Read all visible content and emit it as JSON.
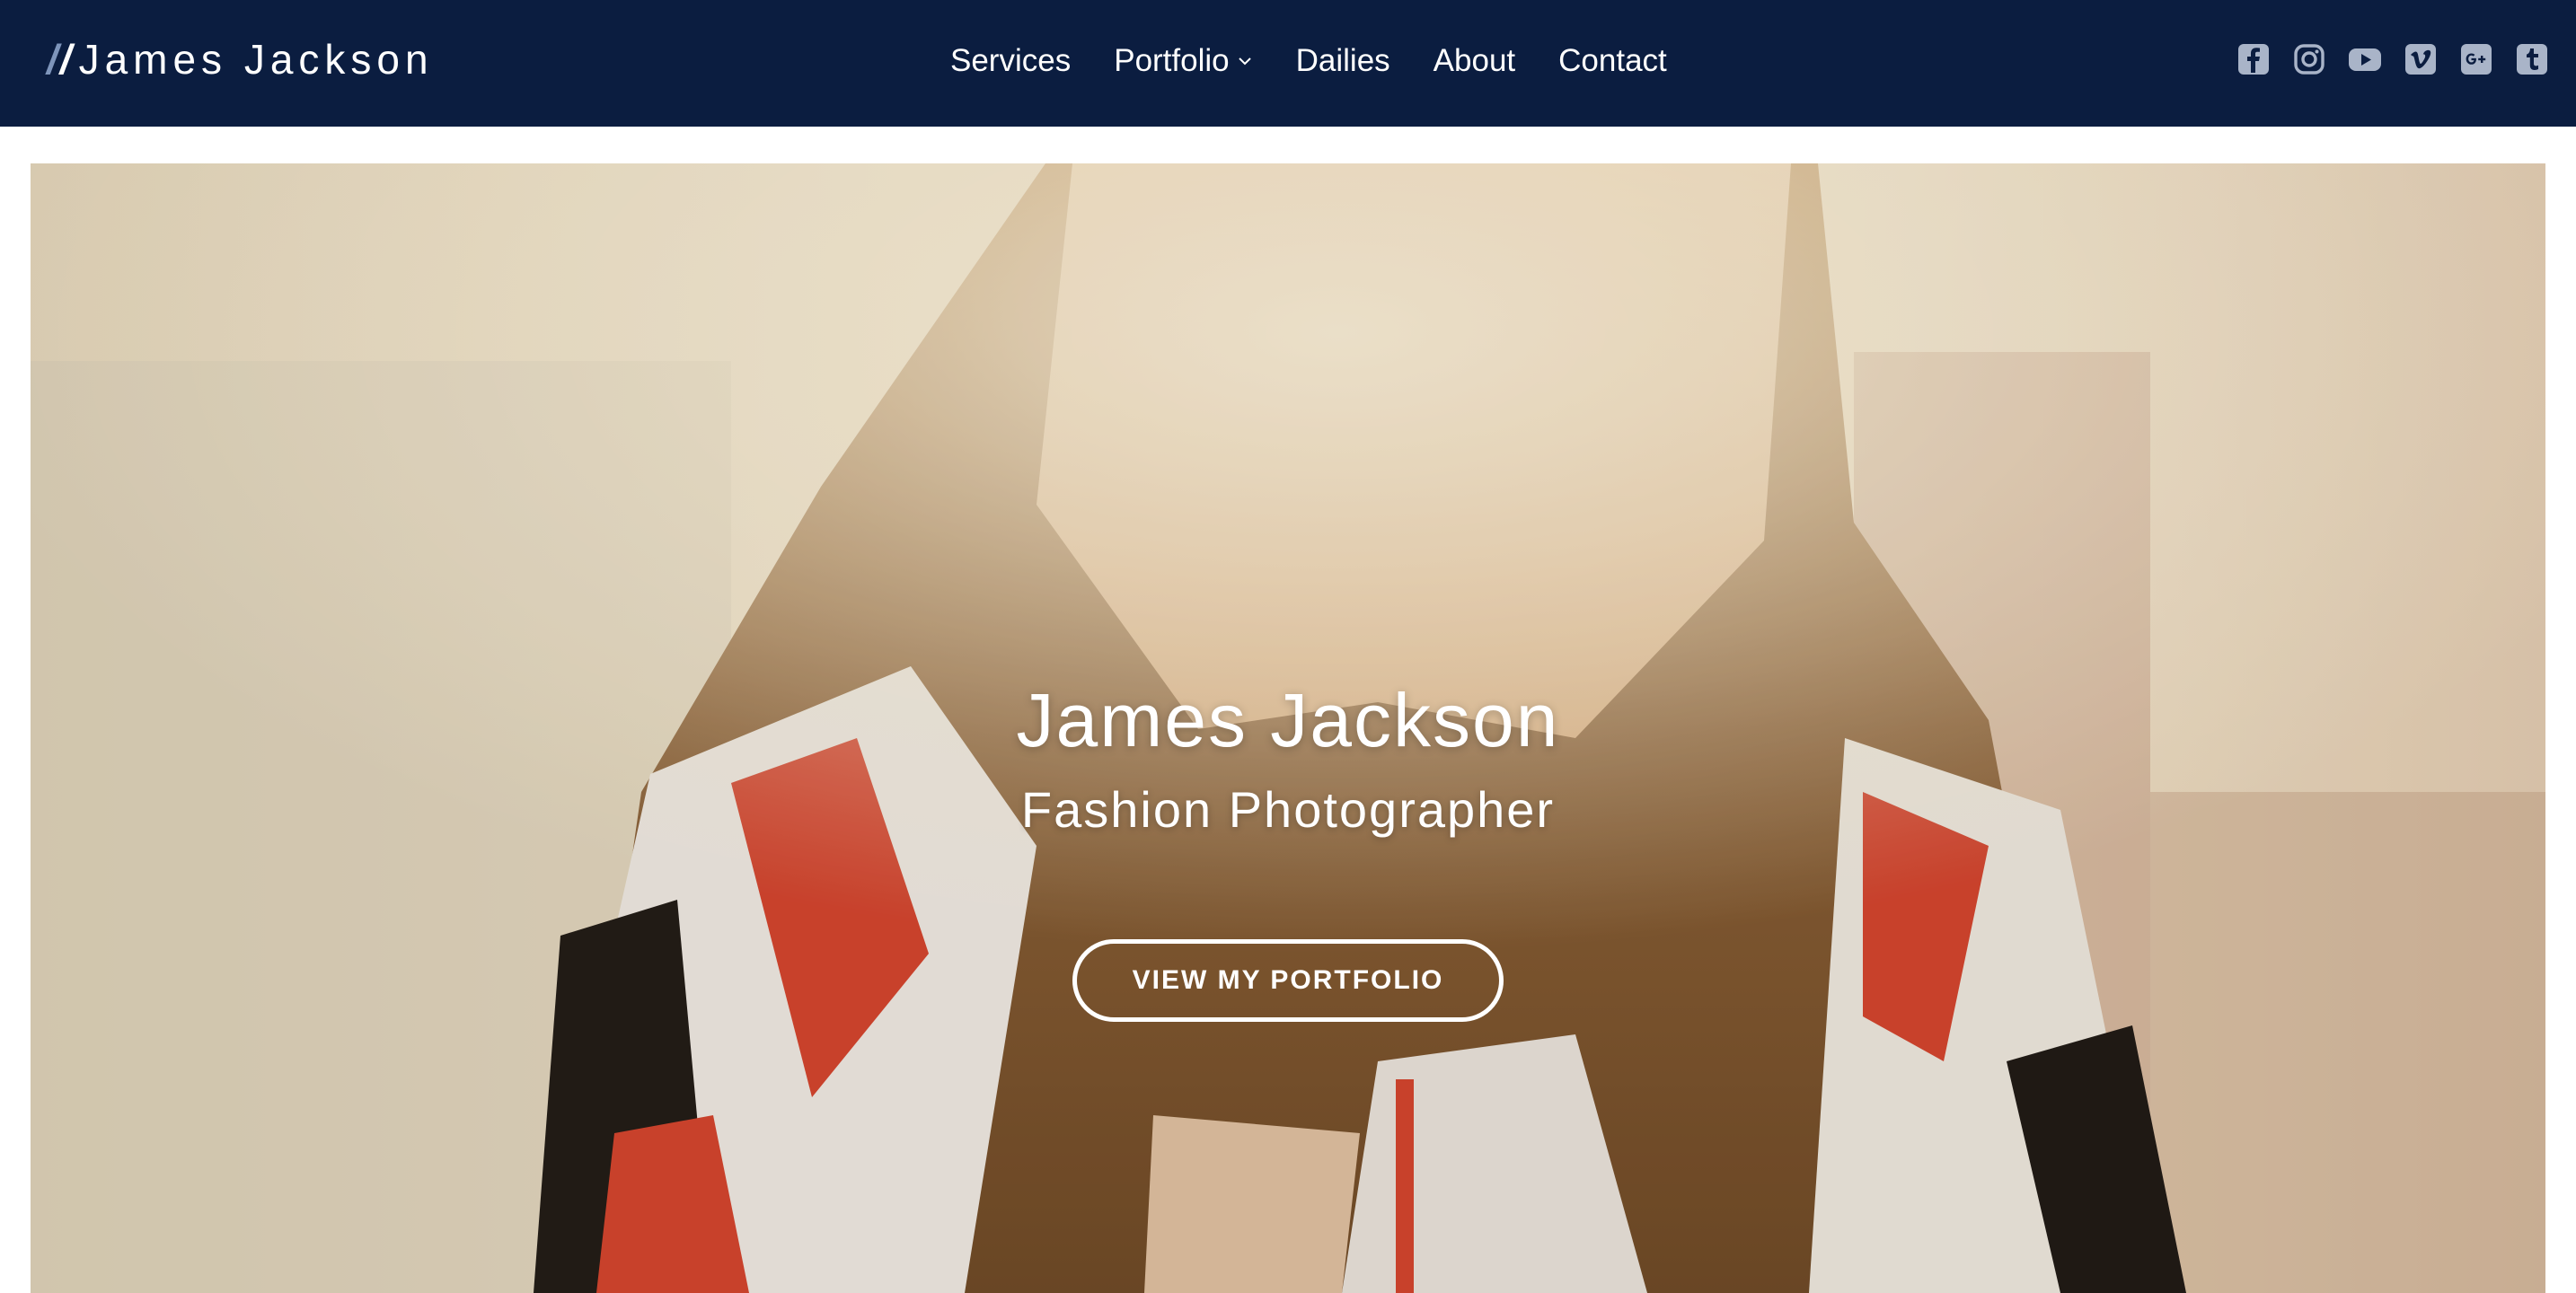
{
  "brand": {
    "slash_1": "/",
    "slash_2": "/",
    "name": "James Jackson"
  },
  "nav": {
    "items": [
      {
        "label": "Services",
        "has_dropdown": false
      },
      {
        "label": "Portfolio",
        "has_dropdown": true
      },
      {
        "label": "Dailies",
        "has_dropdown": false
      },
      {
        "label": "About",
        "has_dropdown": false
      },
      {
        "label": "Contact",
        "has_dropdown": false
      }
    ]
  },
  "social": {
    "icons": [
      "facebook-icon",
      "instagram-icon",
      "youtube-icon",
      "vimeo-icon",
      "google-plus-icon",
      "tumblr-icon"
    ],
    "icon_color": "#a9b4c8"
  },
  "hero": {
    "title": "James Jackson",
    "subtitle": "Fashion Photographer",
    "button_label": "VIEW MY PORTFOLIO"
  },
  "colors": {
    "navbar_bg": "#0b1d40",
    "brand_slash_accent": "#7e95bb",
    "text_white": "#ffffff"
  }
}
